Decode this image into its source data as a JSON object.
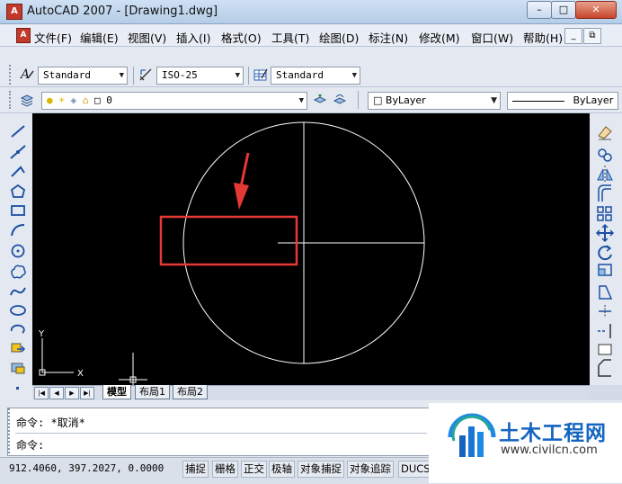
{
  "window": {
    "title": "AutoCAD 2007 - [Drawing1.dwg]",
    "app_icon_text": "A",
    "min_label": "–",
    "max_label": "□",
    "close_label": "✕"
  },
  "menubar": {
    "items": [
      "文件(F)",
      "编辑(E)",
      "视图(V)",
      "插入(I)",
      "格式(O)",
      "工具(T)",
      "绘图(D)",
      "标注(N)",
      "修改(M)",
      "窗口(W)",
      "帮助(H)"
    ],
    "doc_min_label": "_",
    "doc_restore_label": "⧉",
    "doc_close_label": "×"
  },
  "styles_toolbar": {
    "text_style": "Standard",
    "dim_style": "ISO-25",
    "table_style": "Standard"
  },
  "layers_toolbar": {
    "current_layer": "0",
    "color": "ByLayer",
    "linetype": "ByLayer"
  },
  "icons": {
    "text_style": "text-style-icon",
    "dim_style": "dim-style-icon",
    "table_style": "table-style-icon",
    "layer_manager": "layer-manager-icon",
    "draw_tools": [
      "line-icon",
      "construction-line-icon",
      "polyline-icon",
      "polygon-icon",
      "rectangle-icon",
      "arc-icon",
      "circle-icon",
      "revision-cloud-icon",
      "spline-icon",
      "ellipse-icon",
      "ellipse-arc-icon",
      "insert-block-icon",
      "make-block-icon",
      "point-icon"
    ],
    "modify_tools": [
      "erase-icon",
      "copy-icon",
      "mirror-icon",
      "offset-icon",
      "array-icon",
      "move-icon",
      "rotate-icon",
      "scale-icon",
      "stretch-icon",
      "trim-icon",
      "extend-icon",
      "break-icon",
      "chamfer-icon"
    ]
  },
  "canvas": {
    "background": "#000000",
    "ucs_x_label": "X",
    "ucs_y_label": "Y",
    "annotation_color": "#e53935"
  },
  "tabs": {
    "nav": [
      "|◀",
      "◀",
      "▶",
      "▶|"
    ],
    "items": [
      "模型",
      "布局1",
      "布局2"
    ],
    "active": "模型"
  },
  "command": {
    "history_line": "命令: *取消*",
    "prompt": "命令:"
  },
  "status": {
    "coordinates": "912.4060,  397.2027, 0.0000",
    "toggles": [
      "捕捉",
      "栅格",
      "正交",
      "极轴",
      "对象捕捉",
      "对象追踪",
      "DUCS"
    ]
  },
  "watermark": {
    "brand": "土木工程网",
    "url": "www.civilcn.com"
  }
}
